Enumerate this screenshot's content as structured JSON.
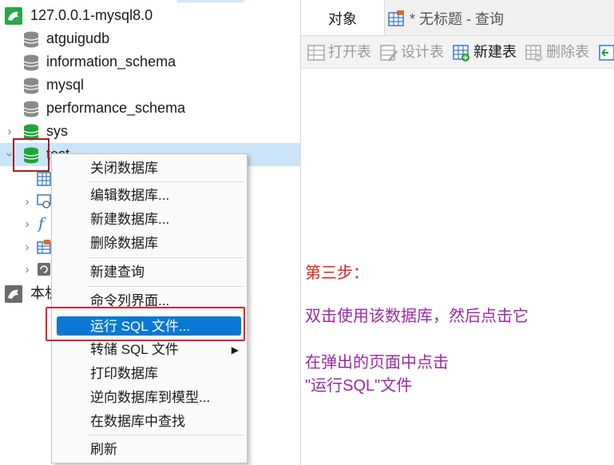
{
  "tree": {
    "connection": "127.0.0.1-mysql8.0",
    "databases": [
      {
        "name": "atguigudb"
      },
      {
        "name": "information_schema"
      },
      {
        "name": "mysql"
      },
      {
        "name": "performance_schema"
      },
      {
        "name": "sys"
      },
      {
        "name": "test"
      }
    ],
    "local_label": "本机"
  },
  "tabs": {
    "objects": "对象",
    "query": "* 无标题 - 查询"
  },
  "toolbar": {
    "open_table": "打开表",
    "design_table": "设计表",
    "new_table": "新建表",
    "delete_table": "删除表"
  },
  "context_menu": {
    "items": [
      "关闭数据库",
      "编辑数据库...",
      "新建数据库...",
      "删除数据库",
      "新建查询",
      "命令列界面...",
      "运行 SQL 文件...",
      "转储 SQL 文件",
      "打印数据库",
      "逆向数据库到模型...",
      "在数据库中查找",
      "刷新"
    ]
  },
  "annotation": {
    "step": "第三步：",
    "line1": "双击使用该数据库，然后点击它",
    "line2": "在弹出的页面中点击",
    "line3": "\"运行SQL\"文件"
  },
  "colors": {
    "db_gray": "#8a8a8a",
    "db_green": "#1fa33a",
    "highlight": "#0a78d4",
    "annotation_red": "#e02020",
    "annotation_purple": "#9b2aa6"
  }
}
